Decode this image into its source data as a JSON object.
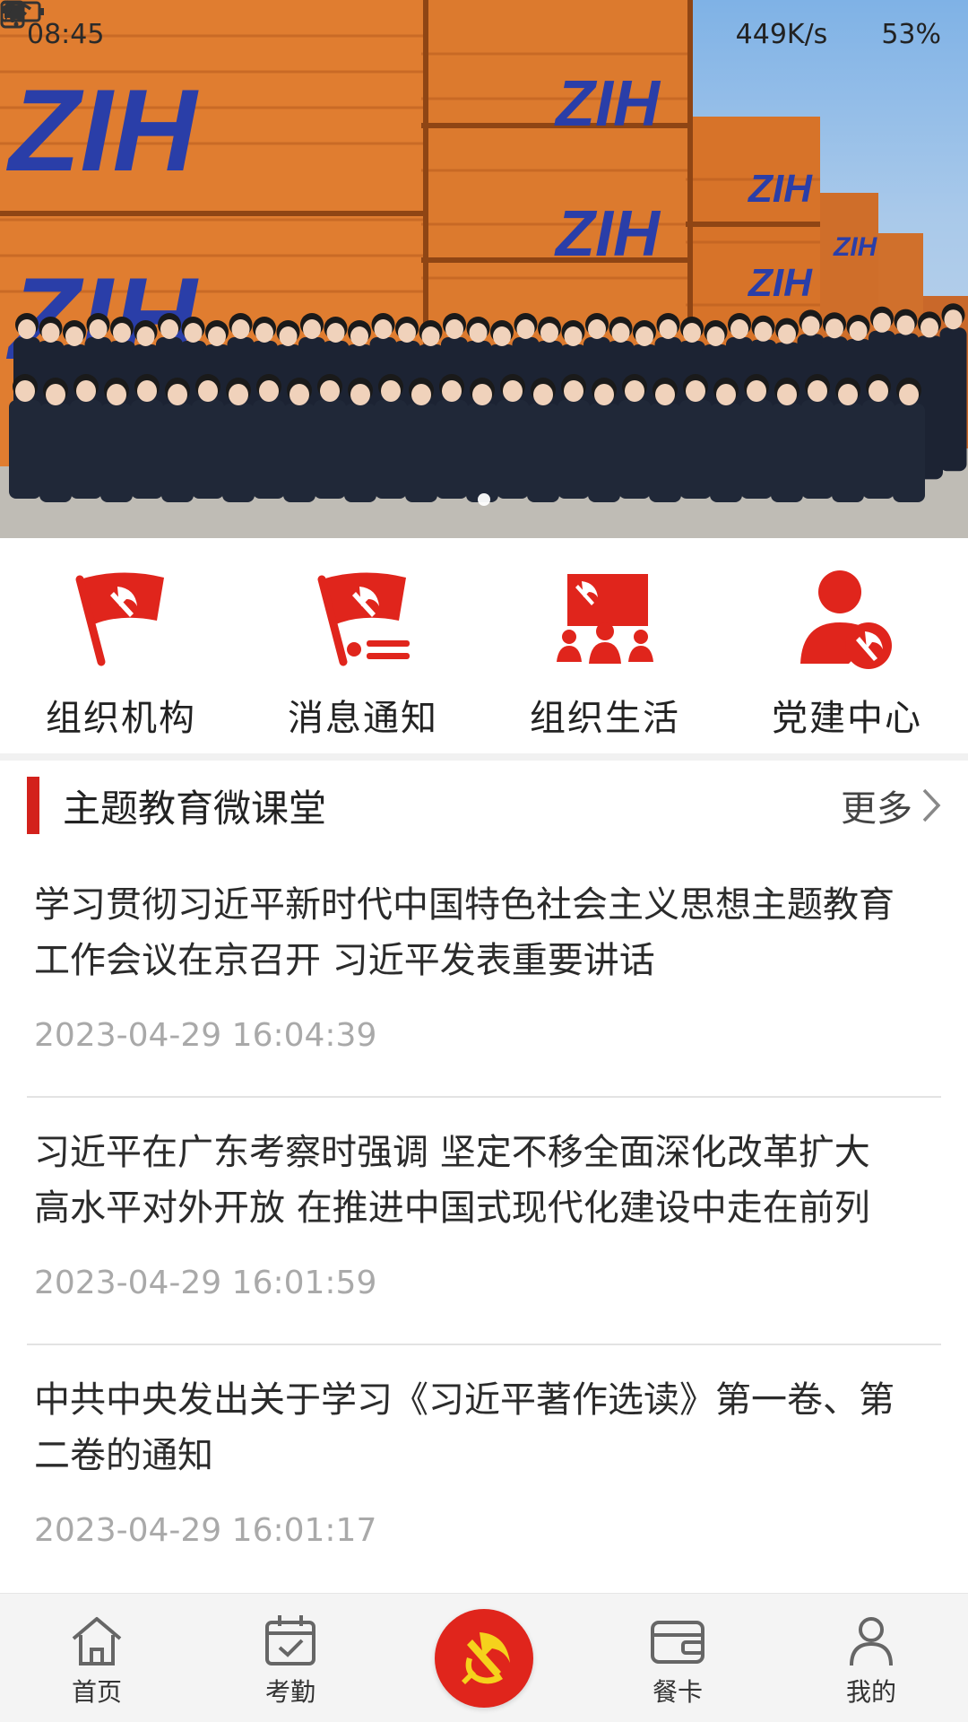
{
  "status_bar": {
    "time": "08:45",
    "speed": "449K/s",
    "battery": "53%",
    "icons": [
      "wifi-icon",
      "alert-icon",
      "battery-icon",
      "charging-icon"
    ]
  },
  "banner": {
    "container_text": "ZIH",
    "active_slide": 1
  },
  "quick_menu": [
    {
      "label": "组织机构",
      "icon": "party-flag-icon"
    },
    {
      "label": "消息通知",
      "icon": "party-flag-message-icon"
    },
    {
      "label": "组织生活",
      "icon": "party-group-icon"
    },
    {
      "label": "党建中心",
      "icon": "party-member-icon"
    }
  ],
  "section": {
    "title": "主题教育微课堂",
    "more": "更多"
  },
  "news": [
    {
      "title": "学习贯彻习近平新时代中国特色社会主义思想主题教育工作会议在京召开 习近平发表重要讲话",
      "time": "2023-04-29 16:04:39"
    },
    {
      "title": "习近平在广东考察时强调 坚定不移全面深化改革扩大高水平对外开放 在推进中国式现代化建设中走在前列",
      "time": "2023-04-29 16:01:59"
    },
    {
      "title": "中共中央发出关于学习《习近平著作选读》第一卷、第二卷的通知",
      "time": "2023-04-29 16:01:17"
    }
  ],
  "bottom_nav": [
    {
      "label": "首页",
      "icon": "home-icon"
    },
    {
      "label": "考勤",
      "icon": "calendar-check-icon"
    },
    {
      "label": "",
      "icon": "party-emblem-icon"
    },
    {
      "label": "餐卡",
      "icon": "card-icon"
    },
    {
      "label": "我的",
      "icon": "user-icon"
    }
  ],
  "colors": {
    "accent": "#d3211c",
    "party_red": "#e0251c",
    "container_orange": "#d9742a",
    "logo_blue": "#2a3ea8",
    "timestamp": "#a9a9a9"
  }
}
